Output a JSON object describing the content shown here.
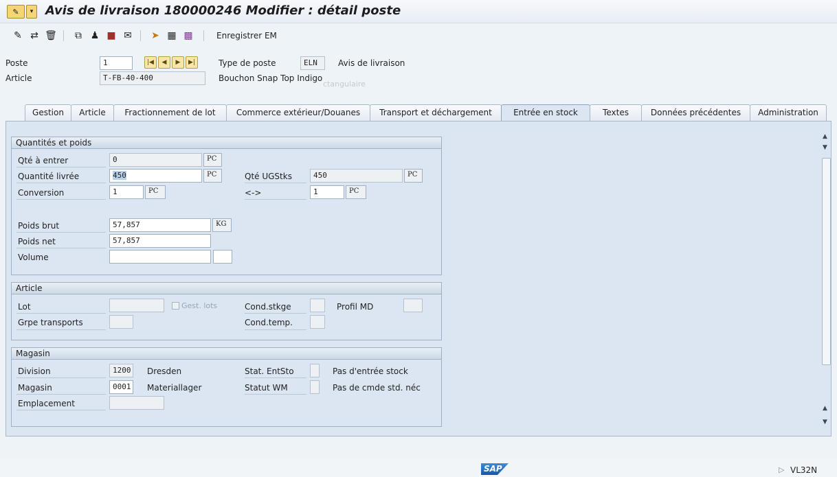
{
  "window": {
    "title": "Avis de livraison 180000246 Modifier : détail poste"
  },
  "toolbar": {
    "icons": [
      "edit-icon",
      "display-change-icon",
      "delete-icon",
      "copy-icon",
      "partner-icon",
      "stock-icon",
      "texts-icon",
      "pick-icon",
      "planning-icon",
      "grid-icon"
    ],
    "enregistrer_label": "Enregistrer EM"
  },
  "header": {
    "poste_label": "Poste",
    "poste_value": "1",
    "type_label": "Type de poste",
    "type_value": "ELN",
    "type_desc": "Avis de livraison",
    "article_label": "Article",
    "article_value": "T-FB-40-400",
    "article_desc": "Bouchon Snap Top Indigo",
    "article_desc_ghost": "ctangulaire"
  },
  "tabs": [
    {
      "label": "Gestion"
    },
    {
      "label": "Article"
    },
    {
      "label": "Fractionnement de lot"
    },
    {
      "label": "Commerce extérieur/Douanes"
    },
    {
      "label": "Transport et déchargement"
    },
    {
      "label": "Entrée en stock"
    },
    {
      "label": "Textes"
    },
    {
      "label": "Données précédentes"
    },
    {
      "label": "Administration"
    }
  ],
  "qty": {
    "title": "Quantités et poids",
    "qte_entrer_label": "Qté à entrer",
    "qte_entrer_value": "0",
    "qte_entrer_unit": "PC",
    "qte_livree_label": "Quantité livrée",
    "qte_livree_value": "450",
    "qte_livree_unit": "PC",
    "qte_ugstks_label": "Qté UGStks",
    "qte_ugstks_value": "450",
    "qte_ugstks_unit": "PC",
    "conversion_label": "Conversion",
    "conversion_value": "1",
    "conversion_unit": "PC",
    "arrow_label": "<->",
    "conversion2_value": "1",
    "conversion2_unit": "PC",
    "poids_brut_label": "Poids brut",
    "poids_brut_value": "57,857",
    "poids_brut_unit": "KG",
    "poids_net_label": "Poids net",
    "poids_net_value": "57,857",
    "volume_label": "Volume",
    "volume_value": "",
    "volume_unit": ""
  },
  "article": {
    "title": "Article",
    "lot_label": "Lot",
    "lot_value": "",
    "gest_lots_label": "Gest. lots",
    "cond_stkge_label": "Cond.stkge",
    "cond_stkge_value": "",
    "profil_md_label": "Profil MD",
    "profil_md_value": "",
    "grpe_transports_label": "Grpe transports",
    "grpe_transports_value": "",
    "cond_temp_label": "Cond.temp.",
    "cond_temp_value": ""
  },
  "magasin": {
    "title": "Magasin",
    "division_label": "Division",
    "division_value": "1200",
    "division_desc": "Dresden",
    "stat_entsto_label": "Stat. EntSto",
    "stat_entsto_value": "",
    "stat_entsto_desc": "Pas d'entrée stock",
    "magasin_label": "Magasin",
    "magasin_value": "0001",
    "magasin_desc": "Materiallager",
    "statut_wm_label": "Statut WM",
    "statut_wm_value": "",
    "statut_wm_desc": "Pas de cmde std. néc",
    "emplacement_label": "Emplacement",
    "emplacement_value": ""
  },
  "status": {
    "sap_logo": "SAP",
    "tcode": "VL32N"
  },
  "colors": {
    "content_bg": "#dbe6f2",
    "title_bar": "#e6edf5",
    "sap_blue": "#1558a8"
  }
}
